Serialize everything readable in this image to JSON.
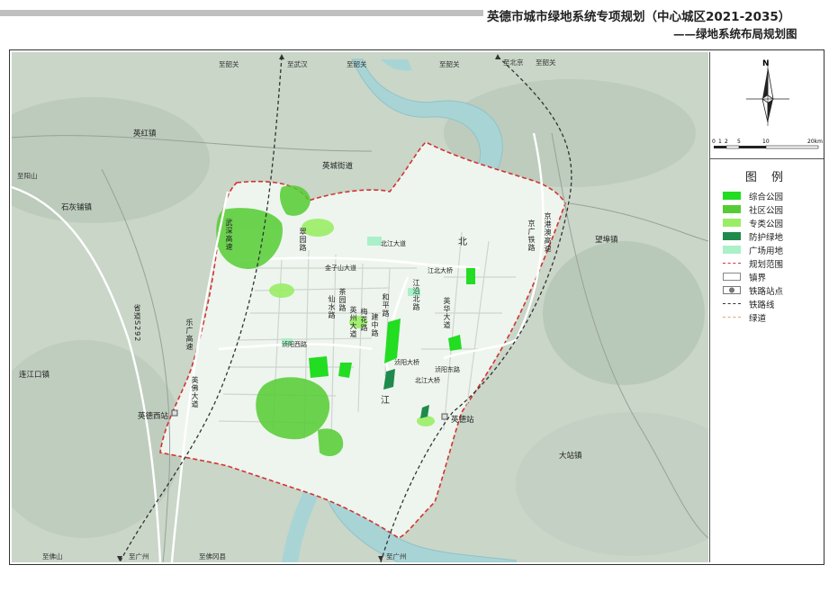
{
  "title": {
    "main": "英德市城市绿地系统专项规划（中心城区2021-2035）",
    "sub": "——绿地系统布局规划图"
  },
  "compass": {
    "north": "N"
  },
  "scalebar": {
    "labels": [
      "0",
      "1",
      "2",
      "5",
      "10",
      "20km"
    ]
  },
  "legend": {
    "title": "图 例",
    "items": [
      {
        "label": "综合公园",
        "color": "#22dd22",
        "style": "fill"
      },
      {
        "label": "社区公园",
        "color": "#55cc33",
        "style": "fill"
      },
      {
        "label": "专类公园",
        "color": "#99ee66",
        "style": "fill"
      },
      {
        "label": "防护绿地",
        "color": "#1f8a4c",
        "style": "fill"
      },
      {
        "label": "广场用地",
        "color": "#aaf0c8",
        "style": "fill"
      },
      {
        "label": "规划范围",
        "color": "#d33333",
        "style": "dashed"
      },
      {
        "label": "镇界",
        "color": "#888888",
        "style": "outline"
      },
      {
        "label": "铁路站点",
        "color": "#777777",
        "style": "station"
      },
      {
        "label": "铁路线",
        "color": "#333333",
        "style": "dashed"
      },
      {
        "label": "绿道",
        "color": "#e8a070",
        "style": "dashed"
      }
    ]
  },
  "places": {
    "yinghong": "英红镇",
    "yingcheng": "英城街道",
    "shihuipu": "石灰铺镇",
    "wangbu": "望埠镇",
    "lianjiangkou": "连江口镇",
    "dazhan": "大站镇",
    "yingdexi": "英德西站",
    "yingde": "英德站",
    "bei": "北",
    "jiang": "江"
  },
  "roads": {
    "jinzishan": "金子山大道",
    "beijiang": "北江大道",
    "jiangbei": "江北大桥",
    "cuiyuan": "翠园路",
    "xianshui": "仙水路",
    "chayuan": "茶园路",
    "yingzhou": "英州大道",
    "meihua": "梅花路",
    "jianzhong": "建中路",
    "heping": "和平路",
    "jiangyanbei": "江沿北路",
    "yinghuadao": "英华大道",
    "zhenyang": "浈阳西路",
    "zhenyangdong": "浈阳东路",
    "zhenyangqiao": "浈阳大桥",
    "beijiangdaqiao": "北江大桥",
    "yingfo": "英佛大道",
    "jinggang": "京港澳高速",
    "jingguang": "京广铁路",
    "wugang": "武深高速",
    "legong": "乐广高速",
    "shengdao": "省道S292"
  },
  "directions": {
    "zhishaoguan1": "至韶关",
    "zhiwuhan": "至武汉",
    "zhishaoguan2": "至韶关",
    "zhishaoguan3": "至韶关",
    "zhibeijing": "至北京",
    "zhishaoguan4": "至韶关",
    "zhiyangshan": "至阳山",
    "zhifoshan": "至佛山",
    "zhiguangzhou1": "至广州",
    "zhifogang": "至佛冈县",
    "zhiguangzhou2": "至广州"
  }
}
